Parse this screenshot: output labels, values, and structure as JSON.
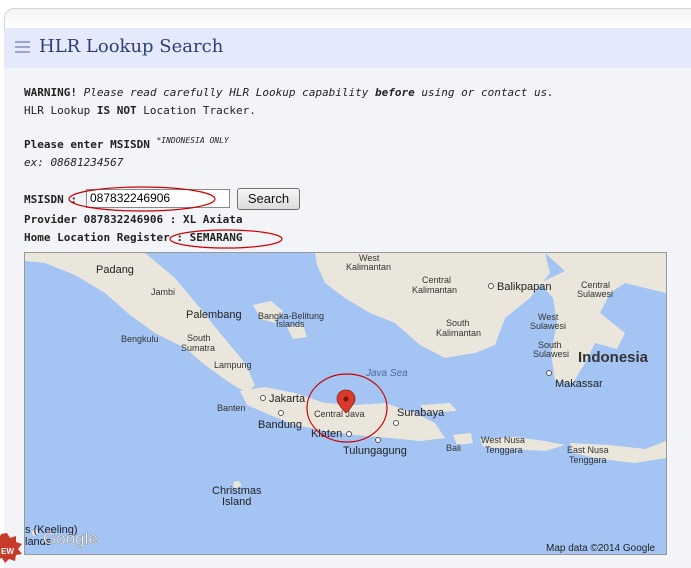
{
  "header": {
    "title": "HLR Lookup Search",
    "menu_icon": "hamburger-menu-icon"
  },
  "warning": {
    "label": "WARNING!",
    "text_a": "Please read carefully HLR Lookup capability",
    "emph": "before",
    "text_b": "using or contact us.",
    "line2_a": "HLR Lookup",
    "line2_b": "IS NOT",
    "line2_c": "Location Tracker."
  },
  "prompt": {
    "label": "Please enter MSISDN",
    "note": "*INDONESIA ONLY",
    "example": "ex: 08681234567"
  },
  "form": {
    "field_label": "MSISDN :",
    "value": "087832246906",
    "button": "Search"
  },
  "result": {
    "provider": "Provider 087832246906 : XL Axiata",
    "hlr_label": "Home Location Register",
    "hlr_value": ": SEMARANG"
  },
  "map": {
    "labels": {
      "padang": "Padang",
      "jambi": "Jambi",
      "palembang": "Palembang",
      "bengkulu": "Bengkulu",
      "south_sumatra_1": "South",
      "south_sumatra_2": "Sumatra",
      "lampung": "Lampung",
      "bangka_1": "Bangka-Belitung",
      "bangka_2": "Islands",
      "west_kal_1": "West",
      "west_kal_2": "Kalimantan",
      "central_kal_1": "Central",
      "central_kal_2": "Kalimantan",
      "south_kal_1": "South",
      "south_kal_2": "Kalimantan",
      "balikpapan": "Balikpapan",
      "central_sul_1": "Central",
      "central_sul_2": "Sulawesi",
      "west_sul_1": "West",
      "west_sul_2": "Sulawesi",
      "south_sul_1": "South",
      "south_sul_2": "Sulawesi",
      "indonesia": "Indonesia",
      "makassar": "Makassar",
      "java_sea": "Java Sea",
      "jakarta": "Jakarta",
      "banten": "Banten",
      "bandung": "Bandung",
      "central_java": "Central Java",
      "klaten": "Klaten",
      "surabaya": "Surabaya",
      "tulungagung": "Tulungagung",
      "bali": "Bali",
      "west_nusa_1": "West Nusa",
      "west_nusa_2": "Tenggara",
      "east_nusa_1": "East Nusa",
      "east_nusa_2": "Tenggara",
      "christmas_1": "Christmas",
      "christmas_2": "Island",
      "keeling_1": "s (Keeling)",
      "keeling_2": "lands",
      "google": "Google",
      "copyright": "Map data ©2014 Google"
    },
    "marker_icon": "map-pin-icon"
  },
  "colors": {
    "header_bg": "#e4e9fb",
    "title": "#2c3f73",
    "sea": "#a4c4f4",
    "land": "#eae6dc",
    "highlight": "#cc0000",
    "marker": "#d93a2c"
  }
}
